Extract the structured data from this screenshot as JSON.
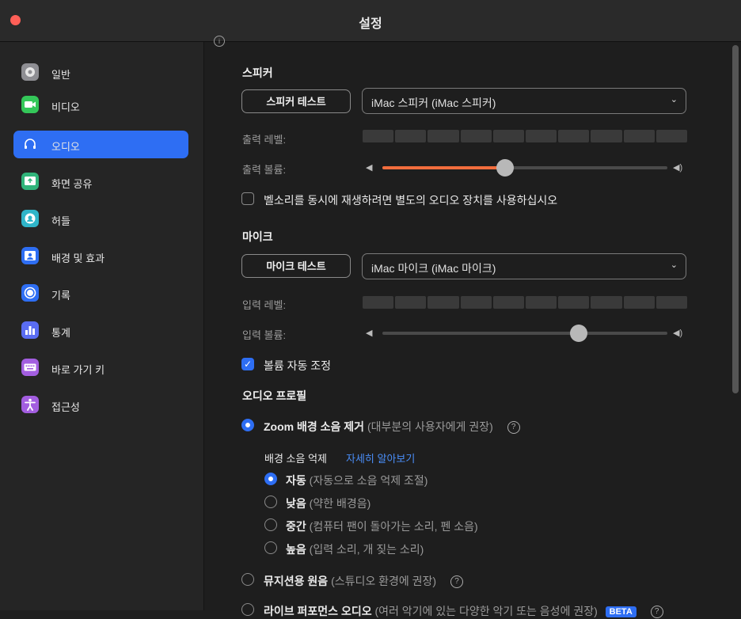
{
  "window": {
    "title": "설정"
  },
  "sidebar": {
    "items": [
      {
        "label": "일반",
        "icon": "gear-icon",
        "color": "#8e8e93"
      },
      {
        "label": "비디오",
        "icon": "video-camera-icon",
        "color": "#34c759"
      },
      {
        "label": "오디오",
        "icon": "headphones-icon",
        "color": "#2e6ef3",
        "active": true
      },
      {
        "label": "화면 공유",
        "icon": "share-screen-icon",
        "color": "#30b47a"
      },
      {
        "label": "허들",
        "icon": "huddle-icon",
        "color": "#2fb5c9"
      },
      {
        "label": "배경 및 효과",
        "icon": "background-icon",
        "color": "#2e6ef3"
      },
      {
        "label": "기록",
        "icon": "record-icon",
        "color": "#2e6ef3"
      },
      {
        "label": "통계",
        "icon": "statistics-icon",
        "color": "#5a6df2"
      },
      {
        "label": "바로 가기 키",
        "icon": "keyboard-icon",
        "color": "#a35ee0"
      },
      {
        "label": "접근성",
        "icon": "accessibility-icon",
        "color": "#a35ee0"
      }
    ]
  },
  "speaker": {
    "title": "스피커",
    "test_button": "스피커 테스트",
    "device": "iMac 스피커 (iMac 스피커)",
    "output_level_label": "출력 레벨:",
    "output_volume_label": "출력 볼륨:",
    "output_volume": 0.43,
    "separate_ring_label": "벨소리를 동시에 재생하려면 별도의 오디오 장치를 사용하십시오",
    "separate_ring_checked": false
  },
  "mic": {
    "title": "마이크",
    "test_button": "마이크 테스트",
    "device": "iMac 마이크 (iMac 마이크)",
    "input_level_label": "입력 레벨:",
    "input_volume_label": "입력 볼륨:",
    "input_volume": 0.69,
    "auto_adjust_label": "볼륨 자동 조정",
    "auto_adjust_checked": true
  },
  "audio_profile": {
    "title": "오디오 프로필",
    "zoom_noise": {
      "label": "Zoom 배경 소음 제거",
      "hint": "(대부분의 사용자에게 권장)",
      "selected": true
    },
    "suppress_label": "배경 소음 억제",
    "learn_more": "자세히 알아보기",
    "levels": [
      {
        "label": "자동",
        "hint": "(자동으로 소음 억제 조절)",
        "selected": true
      },
      {
        "label": "낮음",
        "hint": "(약한 배경음)",
        "selected": false
      },
      {
        "label": "중간",
        "hint": "(컴퓨터 팬이 돌아가는 소리, 펜 소음)",
        "selected": false
      },
      {
        "label": "높음",
        "hint": "(입력 소리, 개 짖는 소리)",
        "selected": false
      }
    ],
    "musician": {
      "label": "뮤지션용 원음",
      "hint": "(스튜디오 환경에 권장)",
      "selected": false
    },
    "live": {
      "label": "라이브 퍼포먼스 오디오",
      "hint": "(여러 악기에 있는 다양한 악기 또는 음성에 권장)",
      "badge": "BETA",
      "selected": false
    }
  },
  "icons": {
    "help": "?",
    "info": "i",
    "chevron": "⌄"
  }
}
